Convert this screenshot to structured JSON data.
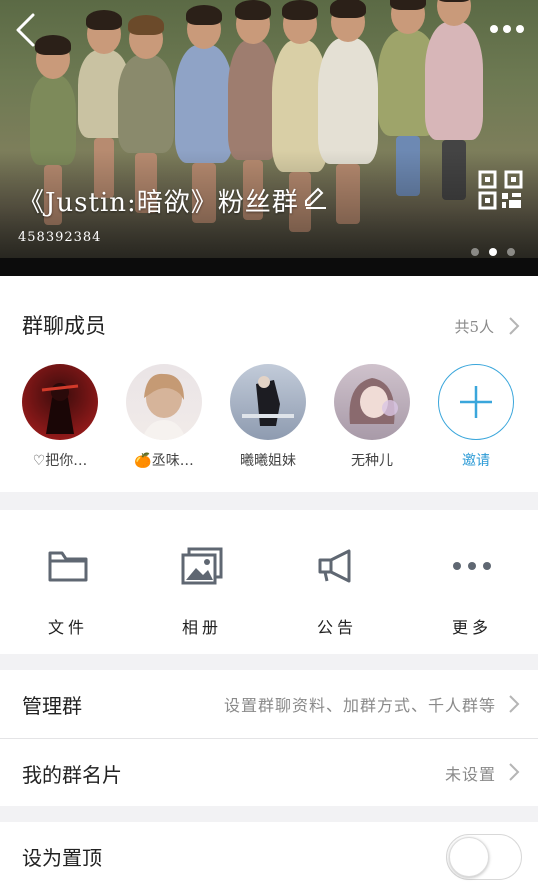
{
  "header": {
    "group_name": "《Justin:暗欲》粉丝群",
    "group_id": "458392384",
    "carousel_dots": 3,
    "active_dot": 1
  },
  "members": {
    "heading": "群聊成员",
    "count_label": "共5人",
    "list": [
      {
        "name": "♡把你…",
        "avatar_color": "#8a1a1a"
      },
      {
        "name": "🍊丞味…",
        "avatar_color": "#e9d8d0"
      },
      {
        "name": "曦曦姐妹",
        "avatar_color": "#9aa4b6"
      },
      {
        "name": "无种儿",
        "avatar_color": "#b6a6b4"
      }
    ],
    "invite_label": "邀请"
  },
  "tools": [
    {
      "icon": "folder-icon",
      "label": "文件"
    },
    {
      "icon": "album-icon",
      "label": "相册"
    },
    {
      "icon": "megaphone-icon",
      "label": "公告"
    },
    {
      "icon": "more-dots-icon",
      "label": "更多"
    }
  ],
  "settings": {
    "manage": {
      "title": "管理群",
      "value": "设置群聊资料、加群方式、千人群等"
    },
    "card": {
      "title": "我的群名片",
      "value": "未设置"
    },
    "pin": {
      "title": "设为置顶",
      "enabled": false
    }
  },
  "colors": {
    "accent": "#2d9bd6",
    "icon_gray": "#5f6772",
    "secondary_text": "#8a8a8a"
  }
}
